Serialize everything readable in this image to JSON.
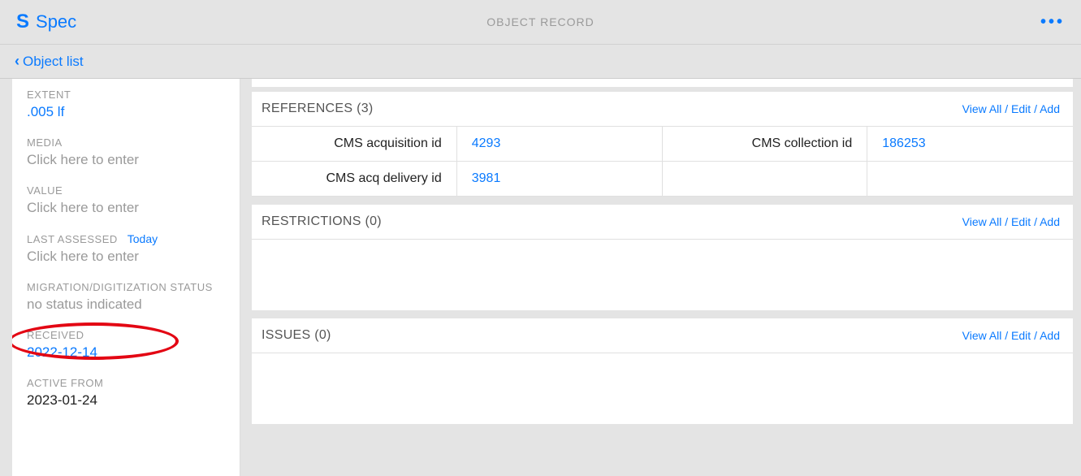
{
  "header": {
    "app_name": "Spec",
    "page_title": "OBJECT RECORD"
  },
  "breadcrumb": {
    "back_label": "Object list"
  },
  "sidebar": {
    "extent": {
      "label": "EXTENT",
      "value": ".005 lf"
    },
    "media": {
      "label": "MEDIA",
      "placeholder": "Click here to enter"
    },
    "value": {
      "label": "VALUE",
      "placeholder": "Click here to enter"
    },
    "last_assessed": {
      "label": "LAST ASSESSED",
      "inline_link": "Today",
      "placeholder": "Click here to enter"
    },
    "mig_status": {
      "label": "MIGRATION/DIGITIZATION STATUS",
      "value": "no status indicated"
    },
    "received": {
      "label": "RECEIVED",
      "value": "2022-12-14"
    },
    "active_from": {
      "label": "ACTIVE FROM",
      "value": "2023-01-24"
    }
  },
  "references": {
    "title": "REFERENCES (3)",
    "actions": "View All / Edit / Add",
    "rows": [
      {
        "label1": "CMS acquisition id",
        "value1": "4293",
        "label2": "CMS collection id",
        "value2": "186253"
      },
      {
        "label1": "CMS acq delivery id",
        "value1": "3981",
        "label2": "",
        "value2": ""
      }
    ]
  },
  "restrictions": {
    "title": "RESTRICTIONS (0)",
    "actions": "View All / Edit / Add"
  },
  "issues": {
    "title": "ISSUES (0)",
    "actions": "View All / Edit / Add"
  }
}
